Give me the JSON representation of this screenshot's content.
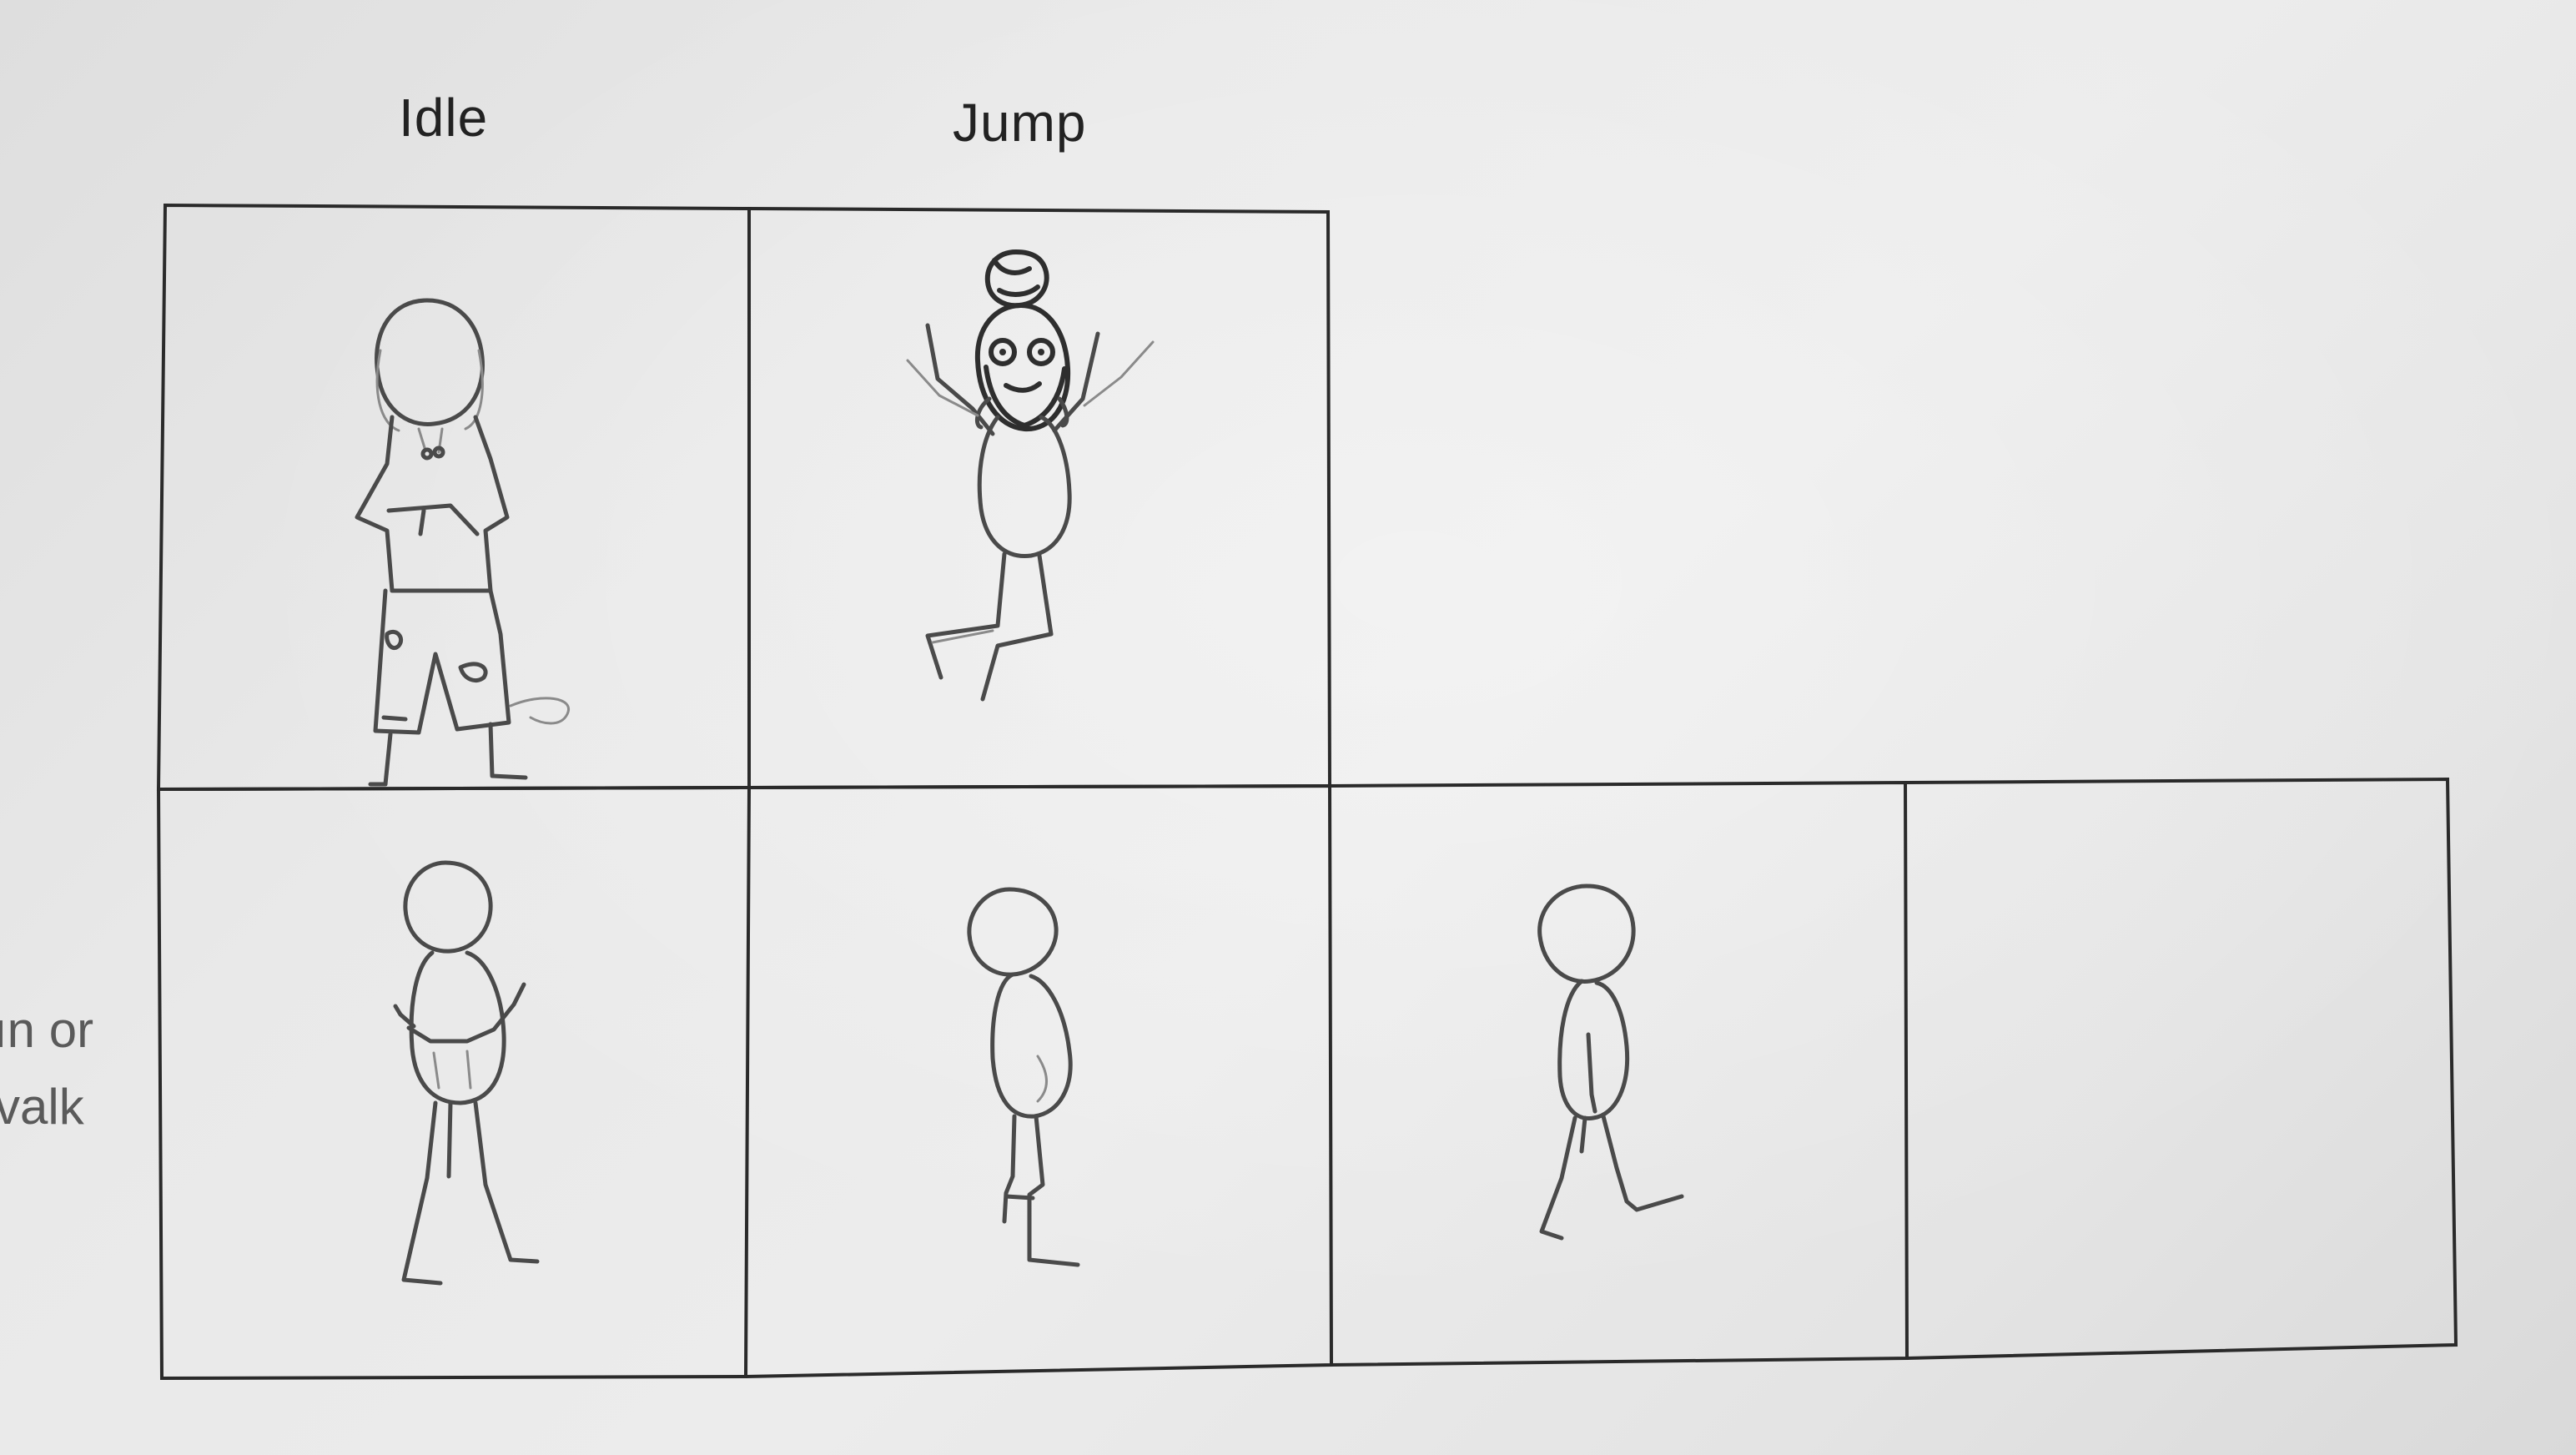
{
  "worksheet": {
    "columns": [
      {
        "label": "Idle"
      },
      {
        "label": "Jump"
      }
    ],
    "row_label_lines": [
      "ın or",
      "valk"
    ],
    "frames": [
      {
        "row": 1,
        "col": 1,
        "drawing": "stick figure in hoodie and ripped pants, standing"
      },
      {
        "row": 1,
        "col": 2,
        "drawing": "stick figure with hair bun and beard, arms raised, mid-jump"
      },
      {
        "row": 2,
        "col": 1,
        "drawing": "stick figure, walk frame 1"
      },
      {
        "row": 2,
        "col": 2,
        "drawing": "stick figure, walk frame 2"
      },
      {
        "row": 2,
        "col": 3,
        "drawing": "stick figure, walk frame 3"
      },
      {
        "row": 2,
        "col": 4,
        "drawing": ""
      }
    ]
  },
  "colors": {
    "paper": "#e8e8e8",
    "frame_line": "#2a2a2a",
    "pencil": "#4a4a4a",
    "label_text": "#222222",
    "faded_text": "#5a5a5a"
  }
}
